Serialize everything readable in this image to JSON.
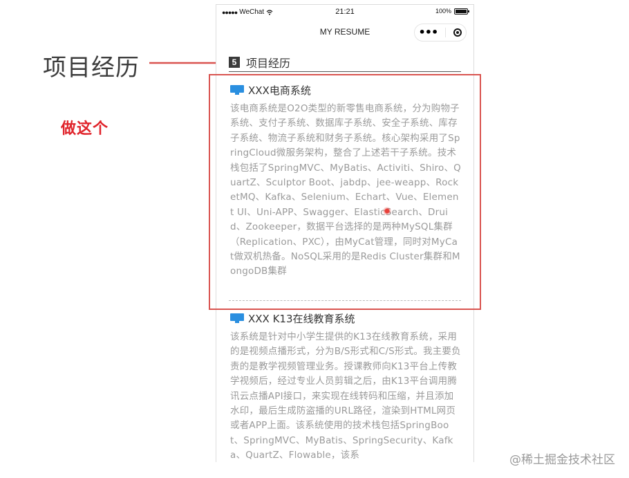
{
  "annotation": {
    "title": "项目经历",
    "note": "做这个",
    "accent_color": "#d9534f"
  },
  "status_bar": {
    "carrier": "WeChat",
    "signal": "●●●●●",
    "wifi_icon": "wifi-icon",
    "time": "21:21",
    "battery": "100%"
  },
  "navbar": {
    "title": "MY RESUME",
    "more_label": "•••",
    "close_icon": "target-icon"
  },
  "section": {
    "number": "5",
    "title": "项目经历"
  },
  "projects": [
    {
      "icon": "monitor-icon",
      "name": "XXX电商系统",
      "description": "该电商系统是O2O类型的新零售电商系统，分为购物子系统、支付子系统、数据库子系统、安全子系统、库存子系统、物流子系统和财务子系统。核心架构采用了SpringCloud微服务架构，整合了上述若干子系统。技术栈包括了SpringMVC、MyBatis、Activiti、Shiro、QuartZ、Sculptor Boot、jabdp、jee-weapp、RocketMQ、Kafka、Selenium、Echart、Vue、Element UI、Uni-APP、Swagger、ElasticSearch、Druid、Zookeeper，数据平台选择的是两种MySQL集群（Replication、PXC），由MyCat管理，同时对MyCat做双机热备。NoSQL采用的是Redis Cluster集群和MongoDB集群"
    },
    {
      "icon": "monitor-icon",
      "name": "XXX K13在线教育系统",
      "description": "该系统是针对中小学生提供的K13在线教育系统，采用的是视频点播形式，分为B/S形式和C/S形式。我主要负责的是教学视频管理业务。授课教师向K13平台上传教学视频后，经过专业人员剪辑之后，由K13平台调用腾讯云点播API接口，来实现在线转码和压缩，并且添加水印，最后生成防盗播的URL路径，渲染到HTML网页或者APP上面。该系统使用的技术栈包括SpringBoot、SpringMVC、MyBatis、SpringSecurity、Kafka、QuartZ、Flowable，该系"
    }
  ],
  "watermark": "@稀土掘金技术社区",
  "colors": {
    "icon_blue": "#2a8fe0",
    "text_gray": "#9a9a9a",
    "note_red": "#e0242b"
  }
}
